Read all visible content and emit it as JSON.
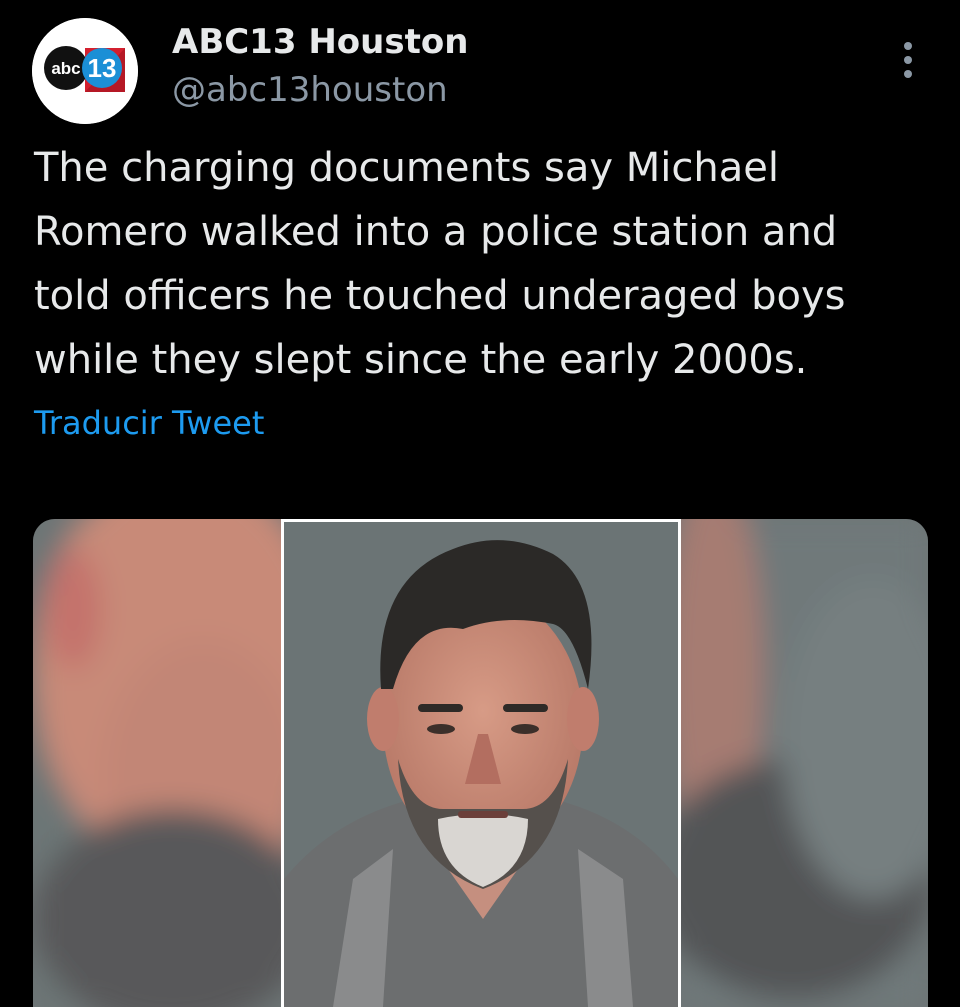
{
  "account": {
    "display_name": "ABC13 Houston",
    "handle": "@abc13houston",
    "logo_text": "abc",
    "logo_number": "13"
  },
  "tweet": {
    "lines": [
      "The charging documents say Michael",
      "Romero walked into a police station and",
      "told officers he touched underaged boys",
      "while they slept since the early 2000s."
    ],
    "translate_label": "Traducir Tweet"
  },
  "icons": {
    "more": "more-vertical-icon",
    "avatar": "abc13-logo-icon"
  },
  "colors": {
    "background": "#000000",
    "text": "#e7e9ea",
    "secondary": "#8b98a5",
    "link": "#1d9bf0"
  }
}
